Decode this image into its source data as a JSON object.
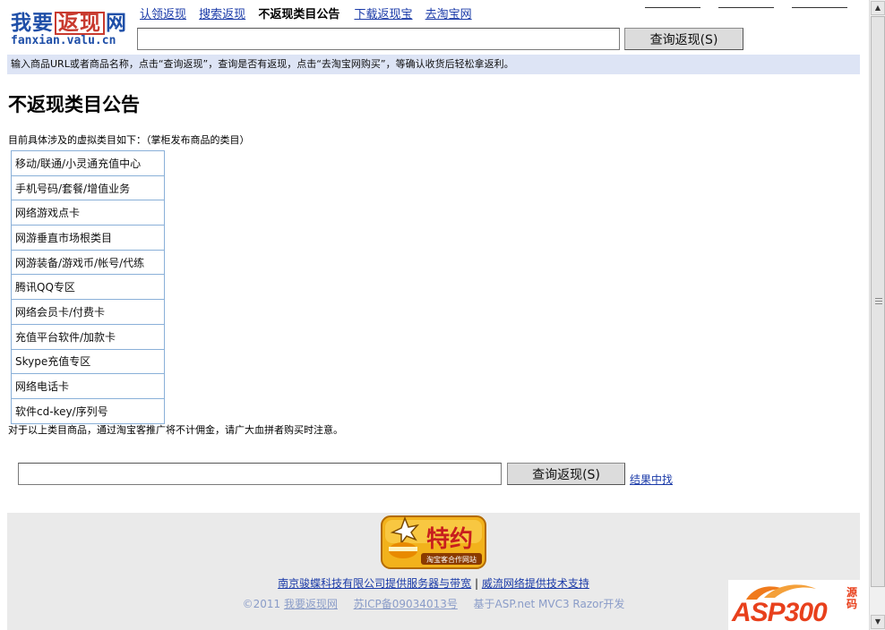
{
  "logo": {
    "part1": "我要",
    "part2": "返现",
    "part3": "网",
    "domain": "fanxian.valu.cn"
  },
  "nav": {
    "links": [
      "认领返现",
      "搜索返现"
    ],
    "current": "不返现类目公告",
    "links_after": [
      "下载返现宝",
      "去淘宝网"
    ]
  },
  "search_top": {
    "value": "",
    "button": "查询返现(S)"
  },
  "tip": "输入商品URL或者商品名称，点击“查询返现”，查询是否有返现，点击“去淘宝网购买”，等确认收货后轻松拿返利。",
  "page_title": "不返现类目公告",
  "intro": "目前具体涉及的虚拟类目如下：（掌柜发布商品的类目）",
  "categories": [
    "移动/联通/小灵通充值中心",
    "手机号码/套餐/增值业务",
    "网络游戏点卡",
    "网游垂直市场根类目",
    "网游装备/游戏币/帐号/代练",
    "腾讯QQ专区",
    "网络会员卡/付费卡",
    "充值平台软件/加款卡",
    "Skype充值专区",
    "网络电话卡",
    "软件cd-key/序列号"
  ],
  "notice": "对于以上类目商品，通过淘宝客推广将不计佣金，请广大血拼者购买时注意。",
  "search_bottom": {
    "value": "",
    "button": "查询返现(S)",
    "result_link": "结果中找"
  },
  "footer": {
    "badge_title": "特约",
    "badge_sub": "淘宝客合作网站",
    "line1_a": "南京骏蝶科技有限公司提供服务器与带宽",
    "line1_sep": "|",
    "line1_b": "威流网络提供技术支持",
    "copyright": "©2011",
    "site_link": "我要返现网",
    "icp": "苏ICP备09034013号",
    "powered": "基于ASP.net MVC3 Razor开发"
  },
  "watermark": {
    "brand": "ASP300",
    "suffix": "源码"
  },
  "colors": {
    "link": "#1a3aa8",
    "tip_bg": "#dde4f5",
    "table_border": "#8ab0d8",
    "footer_bg": "#eaeaea",
    "logo_blue": "#1f4fa8",
    "logo_red": "#c83a2f",
    "badge_gold": "#f2b21c"
  }
}
